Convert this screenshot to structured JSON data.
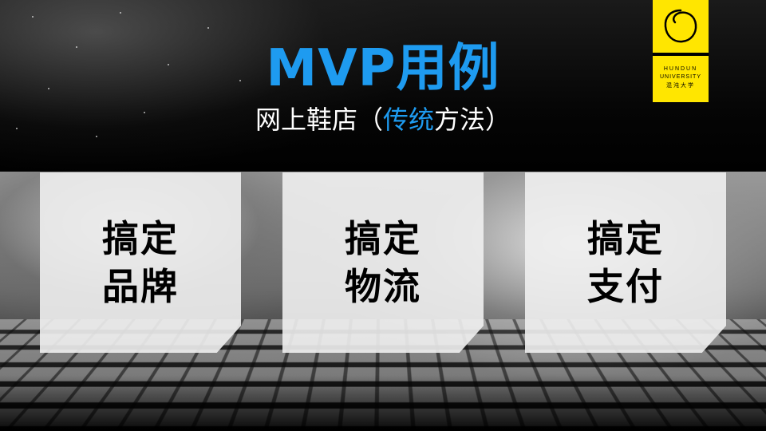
{
  "title": "MVP用例",
  "subtitle": {
    "prefix": "网上鞋店（",
    "highlight": "传统",
    "suffix": "方法）"
  },
  "logo": {
    "line1": "HUNDUN",
    "line2": "UNIVERSITY",
    "line3": "混沌大学"
  },
  "cards": [
    {
      "line1": "搞定",
      "line2": "品牌"
    },
    {
      "line1": "搞定",
      "line2": "物流"
    },
    {
      "line1": "搞定",
      "line2": "支付"
    }
  ],
  "colors": {
    "accent": "#1e9bf0",
    "logo_bg": "#ffe600",
    "background": "#000000",
    "card_bg": "#f0f0f0"
  }
}
